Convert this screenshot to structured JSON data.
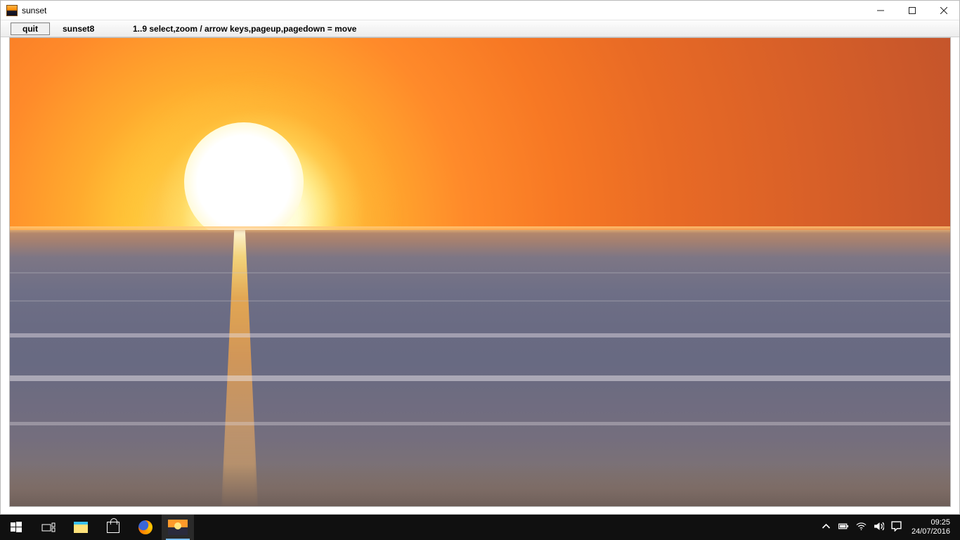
{
  "window": {
    "title": "sunset",
    "controls": {
      "minimize": "minimize",
      "maximize": "maximize",
      "close": "close"
    }
  },
  "toolbar": {
    "quit_label": "quit",
    "file_label": "sunset8",
    "help_text": "1..9 select,zoom / arrow keys,pageup,pagedown = move"
  },
  "image": {
    "subject": "sunset over ocean",
    "description": "Bright sun near horizon with orange sky, calm sea and vertical sun reflection on water"
  },
  "taskbar": {
    "items": [
      {
        "name": "start",
        "icon": "windows-icon",
        "active": false
      },
      {
        "name": "task-view",
        "icon": "taskview-icon",
        "active": false
      },
      {
        "name": "file-explorer",
        "icon": "explorer-icon",
        "active": false
      },
      {
        "name": "store",
        "icon": "store-icon",
        "active": false
      },
      {
        "name": "firefox",
        "icon": "firefox-icon",
        "active": false
      },
      {
        "name": "sunset-app",
        "icon": "sunset-app-icon",
        "active": true
      }
    ],
    "tray": {
      "icons": [
        "chevron-up-icon",
        "battery-icon",
        "wifi-icon",
        "volume-icon",
        "action-center-icon"
      ],
      "time": "09:25",
      "date": "24/07/2016"
    }
  }
}
